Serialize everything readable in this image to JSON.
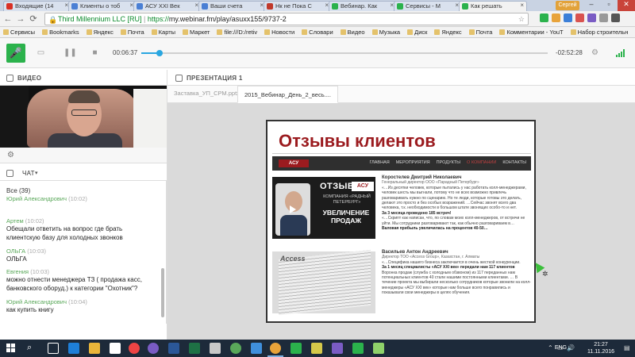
{
  "browser": {
    "tabs": [
      {
        "label": "Входящие (14",
        "color": "#d93025",
        "active": false
      },
      {
        "label": "Клиенты о тоб",
        "color": "#4a7fd4",
        "active": false
      },
      {
        "label": "АСУ XXI Век",
        "color": "#4a7fd4",
        "active": false
      },
      {
        "label": "Ваши счета",
        "color": "#4a7fd4",
        "active": false
      },
      {
        "label": "Нк не Пока С",
        "color": "#c0392b",
        "active": false
      },
      {
        "label": "Вебинар. Как",
        "color": "#2bb24c",
        "active": false
      },
      {
        "label": "Сервисы - М",
        "color": "#2bb24c",
        "active": false
      },
      {
        "label": "Как решать",
        "color": "#2bb24c",
        "active": true
      }
    ],
    "user_badge": "Сергей",
    "secure_label": "Third Millennium LLC [RU]",
    "url_scheme": "https://",
    "url_rest": "my.webinar.fm/play/asuxx155/9737-2"
  },
  "bookmarks": [
    "Сервисы",
    "Bookmarks",
    "Яндекс",
    "Почта",
    "Карты",
    "Маркет",
    "file:///D:/retiv",
    "Новости",
    "Словари",
    "Видео",
    "Музыка",
    "Диск",
    "Яндекс",
    "Почта",
    "Комментарии - YouT",
    "Набор строительн"
  ],
  "player": {
    "time_elapsed": "00:06:37",
    "time_remaining": "-02:52:28",
    "progress": 0.045
  },
  "video": {
    "label": "ВИДЕО"
  },
  "presentation": {
    "label": "ПРЕЗЕНТАЦИЯ 1",
    "tabs": [
      "Заставка_УП_СРМ.pptx",
      "2015_Вебинар_День_2_весь...."
    ]
  },
  "chat": {
    "label": "ЧАТ",
    "count": "Все (39)",
    "messages": [
      {
        "name": "Юрий Александрович",
        "time": "(10:02)",
        "text": ""
      },
      {
        "name": "Артем",
        "time": "(10:02)",
        "text": "Обещали ответить на вопрос где брать клиентскую базу для холодных звонков"
      },
      {
        "name": "ОЛЬГА",
        "time": "(10:03)",
        "text": "ОЛЬГА"
      },
      {
        "name": "Евгения",
        "time": "(10:03)",
        "text": "можно отнести менеджера ТЗ ( продажа касс, банковского оборуд.) к категории \"Охотник\"?"
      },
      {
        "name": "Юрий Александрович",
        "time": "(10:04)",
        "text": "как купить книгу"
      }
    ]
  },
  "slide": {
    "title": "Отзывы клиентов",
    "logo": "АСУ",
    "logo_sub": "XXI ВЕК",
    "nav": [
      "ГЛАВНАЯ",
      "МЕРОПРИЯТИЯ",
      "ПРОДУКТЫ",
      "О КОМПАНИИ",
      "КОНТАКТЫ"
    ],
    "reviews": [
      {
        "name": "Коростелев Дмитрий Николаевич",
        "role": "Генеральный директор ООО «Парадный Петербург»",
        "body": "«…Из десятки человек, которые пытались у нас работать колл-менеджерами, человек шесть мы выгнали, потому что не всех возможно привлечь разговаривать нужно по сценарию. Но те люди, которые готовы это делать, делают это просто и без особых возражений. …Сейчас звонят всего два человека, т.к. необходимости в большом штате звонящих особо-то и нет.",
        "bold1": "За 3 месяца проведено 185 встреч!",
        "body2": "«…Скрипт как написан, что, по словам моих колл-менеджеров, от встречи не уйти. Мы сотрудники разговаривают так, как обычно разговариваем в…",
        "bold2": "Валовая прибыль увеличилась на процентов 40-50…",
        "img": {
          "otz": "ОТЗЫВ",
          "asu": "АСУ",
          "company": "КОМПАНИЯ «РАДНЫЙ ПЕТЕРБУРГ»",
          "big": "УВЕЛИЧЕНИЕ ПРОДАЖ"
        }
      },
      {
        "name": "Васильев Антон Андреевич",
        "role": "Директор ТОО «Access Group», Казахстан, г. Алматы",
        "body": "«…Специфика нашего бизнеса заключается в очень жесткой конкуренции.",
        "bold1": "За 1 месяц специалисты «АСУ XXI век» передали нам 117 клиентов",
        "body2": "Воронка продаж (служба с холодным обзвоном) из 117 переданных нам потенциальных клиентов 40 стали нашими постоянными клиентами. … В течение проекта мы выбирали несколько сотрудников которые звонили на колл-менеджеры «АСУ XXI век» которые нам больше всего понравились и показывали свои менеджеры в целях обучения.",
        "bold2": "",
        "img": {
          "access": "Access"
        }
      }
    ]
  },
  "taskbar": {
    "lang": "ENG",
    "time": "21:27",
    "date": "11.11.2016"
  }
}
